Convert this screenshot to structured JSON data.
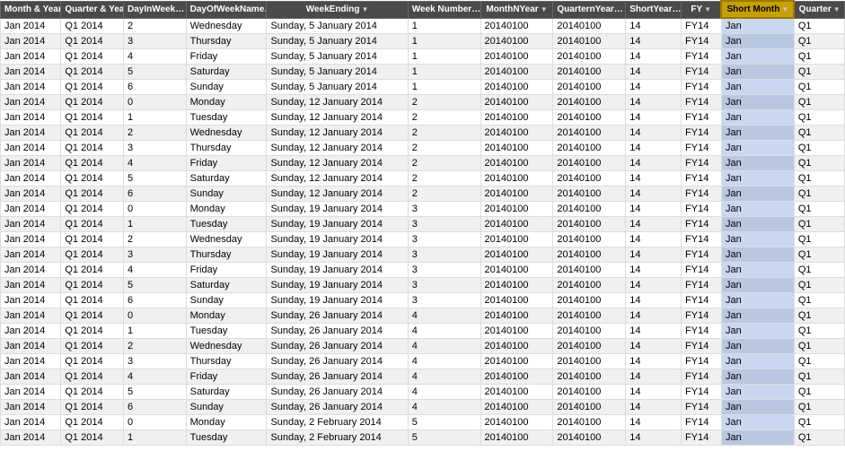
{
  "columns": [
    {
      "key": "month",
      "label": "Month & Year",
      "class": "col-month",
      "active": false
    },
    {
      "key": "quarter",
      "label": "Quarter & Year",
      "class": "col-quarter",
      "active": false
    },
    {
      "key": "dayinweek",
      "label": "DayInWeek",
      "class": "col-dayinweek",
      "active": false
    },
    {
      "key": "dayofweekname",
      "label": "DayOfWeekName",
      "class": "col-dayofweekname",
      "active": false
    },
    {
      "key": "weekending",
      "label": "WeekEnding",
      "class": "col-weekending",
      "active": false
    },
    {
      "key": "weeknumber",
      "label": "Week Number",
      "class": "col-weeknumber",
      "active": false
    },
    {
      "key": "monthnyear",
      "label": "MonthNYear",
      "class": "col-monthnyear",
      "active": false
    },
    {
      "key": "quarternYear",
      "label": "QuarternYear",
      "class": "col-quarternYear",
      "active": false
    },
    {
      "key": "shortyear",
      "label": "ShortYear",
      "class": "col-shortyear",
      "active": false
    },
    {
      "key": "fy",
      "label": "FY",
      "class": "col-fy",
      "active": false
    },
    {
      "key": "shortmonth",
      "label": "Short Month",
      "class": "col-shortmonth",
      "active": true
    },
    {
      "key": "quarterend",
      "label": "Quarter",
      "class": "col-quarterend",
      "active": false
    }
  ],
  "rows": [
    {
      "month": "Jan 2014",
      "quarter": "Q1 2014",
      "dayinweek": "2",
      "dayofweekname": "Wednesday",
      "weekending": "Sunday, 5 January 2014",
      "weeknumber": "1",
      "monthnyear": "20140100",
      "quarternYear": "20140100",
      "shortyear": "14",
      "fy": "FY14",
      "shortmonth": "Jan",
      "quarterend": "Q1"
    },
    {
      "month": "Jan 2014",
      "quarter": "Q1 2014",
      "dayinweek": "3",
      "dayofweekname": "Thursday",
      "weekending": "Sunday, 5 January 2014",
      "weeknumber": "1",
      "monthnyear": "20140100",
      "quarternYear": "20140100",
      "shortyear": "14",
      "fy": "FY14",
      "shortmonth": "Jan",
      "quarterend": "Q1"
    },
    {
      "month": "Jan 2014",
      "quarter": "Q1 2014",
      "dayinweek": "4",
      "dayofweekname": "Friday",
      "weekending": "Sunday, 5 January 2014",
      "weeknumber": "1",
      "monthnyear": "20140100",
      "quarternYear": "20140100",
      "shortyear": "14",
      "fy": "FY14",
      "shortmonth": "Jan",
      "quarterend": "Q1"
    },
    {
      "month": "Jan 2014",
      "quarter": "Q1 2014",
      "dayinweek": "5",
      "dayofweekname": "Saturday",
      "weekending": "Sunday, 5 January 2014",
      "weeknumber": "1",
      "monthnyear": "20140100",
      "quarternYear": "20140100",
      "shortyear": "14",
      "fy": "FY14",
      "shortmonth": "Jan",
      "quarterend": "Q1"
    },
    {
      "month": "Jan 2014",
      "quarter": "Q1 2014",
      "dayinweek": "6",
      "dayofweekname": "Sunday",
      "weekending": "Sunday, 5 January 2014",
      "weeknumber": "1",
      "monthnyear": "20140100",
      "quarternYear": "20140100",
      "shortyear": "14",
      "fy": "FY14",
      "shortmonth": "Jan",
      "quarterend": "Q1"
    },
    {
      "month": "Jan 2014",
      "quarter": "Q1 2014",
      "dayinweek": "0",
      "dayofweekname": "Monday",
      "weekending": "Sunday, 12 January 2014",
      "weeknumber": "2",
      "monthnyear": "20140100",
      "quarternYear": "20140100",
      "shortyear": "14",
      "fy": "FY14",
      "shortmonth": "Jan",
      "quarterend": "Q1"
    },
    {
      "month": "Jan 2014",
      "quarter": "Q1 2014",
      "dayinweek": "1",
      "dayofweekname": "Tuesday",
      "weekending": "Sunday, 12 January 2014",
      "weeknumber": "2",
      "monthnyear": "20140100",
      "quarternYear": "20140100",
      "shortyear": "14",
      "fy": "FY14",
      "shortmonth": "Jan",
      "quarterend": "Q1"
    },
    {
      "month": "Jan 2014",
      "quarter": "Q1 2014",
      "dayinweek": "2",
      "dayofweekname": "Wednesday",
      "weekending": "Sunday, 12 January 2014",
      "weeknumber": "2",
      "monthnyear": "20140100",
      "quarternYear": "20140100",
      "shortyear": "14",
      "fy": "FY14",
      "shortmonth": "Jan",
      "quarterend": "Q1"
    },
    {
      "month": "Jan 2014",
      "quarter": "Q1 2014",
      "dayinweek": "3",
      "dayofweekname": "Thursday",
      "weekending": "Sunday, 12 January 2014",
      "weeknumber": "2",
      "monthnyear": "20140100",
      "quarternYear": "20140100",
      "shortyear": "14",
      "fy": "FY14",
      "shortmonth": "Jan",
      "quarterend": "Q1"
    },
    {
      "month": "Jan 2014",
      "quarter": "Q1 2014",
      "dayinweek": "4",
      "dayofweekname": "Friday",
      "weekending": "Sunday, 12 January 2014",
      "weeknumber": "2",
      "monthnyear": "20140100",
      "quarternYear": "20140100",
      "shortyear": "14",
      "fy": "FY14",
      "shortmonth": "Jan",
      "quarterend": "Q1"
    },
    {
      "month": "Jan 2014",
      "quarter": "Q1 2014",
      "dayinweek": "5",
      "dayofweekname": "Saturday",
      "weekending": "Sunday, 12 January 2014",
      "weeknumber": "2",
      "monthnyear": "20140100",
      "quarternYear": "20140100",
      "shortyear": "14",
      "fy": "FY14",
      "shortmonth": "Jan",
      "quarterend": "Q1"
    },
    {
      "month": "Jan 2014",
      "quarter": "Q1 2014",
      "dayinweek": "6",
      "dayofweekname": "Sunday",
      "weekending": "Sunday, 12 January 2014",
      "weeknumber": "2",
      "monthnyear": "20140100",
      "quarternYear": "20140100",
      "shortyear": "14",
      "fy": "FY14",
      "shortmonth": "Jan",
      "quarterend": "Q1"
    },
    {
      "month": "Jan 2014",
      "quarter": "Q1 2014",
      "dayinweek": "0",
      "dayofweekname": "Monday",
      "weekending": "Sunday, 19 January 2014",
      "weeknumber": "3",
      "monthnyear": "20140100",
      "quarternYear": "20140100",
      "shortyear": "14",
      "fy": "FY14",
      "shortmonth": "Jan",
      "quarterend": "Q1"
    },
    {
      "month": "Jan 2014",
      "quarter": "Q1 2014",
      "dayinweek": "1",
      "dayofweekname": "Tuesday",
      "weekending": "Sunday, 19 January 2014",
      "weeknumber": "3",
      "monthnyear": "20140100",
      "quarternYear": "20140100",
      "shortyear": "14",
      "fy": "FY14",
      "shortmonth": "Jan",
      "quarterend": "Q1"
    },
    {
      "month": "Jan 2014",
      "quarter": "Q1 2014",
      "dayinweek": "2",
      "dayofweekname": "Wednesday",
      "weekending": "Sunday, 19 January 2014",
      "weeknumber": "3",
      "monthnyear": "20140100",
      "quarternYear": "20140100",
      "shortyear": "14",
      "fy": "FY14",
      "shortmonth": "Jan",
      "quarterend": "Q1"
    },
    {
      "month": "Jan 2014",
      "quarter": "Q1 2014",
      "dayinweek": "3",
      "dayofweekname": "Thursday",
      "weekending": "Sunday, 19 January 2014",
      "weeknumber": "3",
      "monthnyear": "20140100",
      "quarternYear": "20140100",
      "shortyear": "14",
      "fy": "FY14",
      "shortmonth": "Jan",
      "quarterend": "Q1"
    },
    {
      "month": "Jan 2014",
      "quarter": "Q1 2014",
      "dayinweek": "4",
      "dayofweekname": "Friday",
      "weekending": "Sunday, 19 January 2014",
      "weeknumber": "3",
      "monthnyear": "20140100",
      "quarternYear": "20140100",
      "shortyear": "14",
      "fy": "FY14",
      "shortmonth": "Jan",
      "quarterend": "Q1"
    },
    {
      "month": "Jan 2014",
      "quarter": "Q1 2014",
      "dayinweek": "5",
      "dayofweekname": "Saturday",
      "weekending": "Sunday, 19 January 2014",
      "weeknumber": "3",
      "monthnyear": "20140100",
      "quarternYear": "20140100",
      "shortyear": "14",
      "fy": "FY14",
      "shortmonth": "Jan",
      "quarterend": "Q1"
    },
    {
      "month": "Jan 2014",
      "quarter": "Q1 2014",
      "dayinweek": "6",
      "dayofweekname": "Sunday",
      "weekending": "Sunday, 19 January 2014",
      "weeknumber": "3",
      "monthnyear": "20140100",
      "quarternYear": "20140100",
      "shortyear": "14",
      "fy": "FY14",
      "shortmonth": "Jan",
      "quarterend": "Q1"
    },
    {
      "month": "Jan 2014",
      "quarter": "Q1 2014",
      "dayinweek": "0",
      "dayofweekname": "Monday",
      "weekending": "Sunday, 26 January 2014",
      "weeknumber": "4",
      "monthnyear": "20140100",
      "quarternYear": "20140100",
      "shortyear": "14",
      "fy": "FY14",
      "shortmonth": "Jan",
      "quarterend": "Q1"
    },
    {
      "month": "Jan 2014",
      "quarter": "Q1 2014",
      "dayinweek": "1",
      "dayofweekname": "Tuesday",
      "weekending": "Sunday, 26 January 2014",
      "weeknumber": "4",
      "monthnyear": "20140100",
      "quarternYear": "20140100",
      "shortyear": "14",
      "fy": "FY14",
      "shortmonth": "Jan",
      "quarterend": "Q1"
    },
    {
      "month": "Jan 2014",
      "quarter": "Q1 2014",
      "dayinweek": "2",
      "dayofweekname": "Wednesday",
      "weekending": "Sunday, 26 January 2014",
      "weeknumber": "4",
      "monthnyear": "20140100",
      "quarternYear": "20140100",
      "shortyear": "14",
      "fy": "FY14",
      "shortmonth": "Jan",
      "quarterend": "Q1"
    },
    {
      "month": "Jan 2014",
      "quarter": "Q1 2014",
      "dayinweek": "3",
      "dayofweekname": "Thursday",
      "weekending": "Sunday, 26 January 2014",
      "weeknumber": "4",
      "monthnyear": "20140100",
      "quarternYear": "20140100",
      "shortyear": "14",
      "fy": "FY14",
      "shortmonth": "Jan",
      "quarterend": "Q1"
    },
    {
      "month": "Jan 2014",
      "quarter": "Q1 2014",
      "dayinweek": "4",
      "dayofweekname": "Friday",
      "weekending": "Sunday, 26 January 2014",
      "weeknumber": "4",
      "monthnyear": "20140100",
      "quarternYear": "20140100",
      "shortyear": "14",
      "fy": "FY14",
      "shortmonth": "Jan",
      "quarterend": "Q1"
    },
    {
      "month": "Jan 2014",
      "quarter": "Q1 2014",
      "dayinweek": "5",
      "dayofweekname": "Saturday",
      "weekending": "Sunday, 26 January 2014",
      "weeknumber": "4",
      "monthnyear": "20140100",
      "quarternYear": "20140100",
      "shortyear": "14",
      "fy": "FY14",
      "shortmonth": "Jan",
      "quarterend": "Q1"
    },
    {
      "month": "Jan 2014",
      "quarter": "Q1 2014",
      "dayinweek": "6",
      "dayofweekname": "Sunday",
      "weekending": "Sunday, 26 January 2014",
      "weeknumber": "4",
      "monthnyear": "20140100",
      "quarternYear": "20140100",
      "shortyear": "14",
      "fy": "FY14",
      "shortmonth": "Jan",
      "quarterend": "Q1"
    },
    {
      "month": "Jan 2014",
      "quarter": "Q1 2014",
      "dayinweek": "0",
      "dayofweekname": "Monday",
      "weekending": "Sunday, 2 February 2014",
      "weeknumber": "5",
      "monthnyear": "20140100",
      "quarternYear": "20140100",
      "shortyear": "14",
      "fy": "FY14",
      "shortmonth": "Jan",
      "quarterend": "Q1"
    },
    {
      "month": "Jan 2014",
      "quarter": "Q1 2014",
      "dayinweek": "1",
      "dayofweekname": "Tuesday",
      "weekending": "Sunday, 2 February 2014",
      "weeknumber": "5",
      "monthnyear": "20140100",
      "quarternYear": "20140100",
      "shortyear": "14",
      "fy": "FY14",
      "shortmonth": "Jan",
      "quarterend": "Q1"
    }
  ],
  "activeColIndex": 10
}
